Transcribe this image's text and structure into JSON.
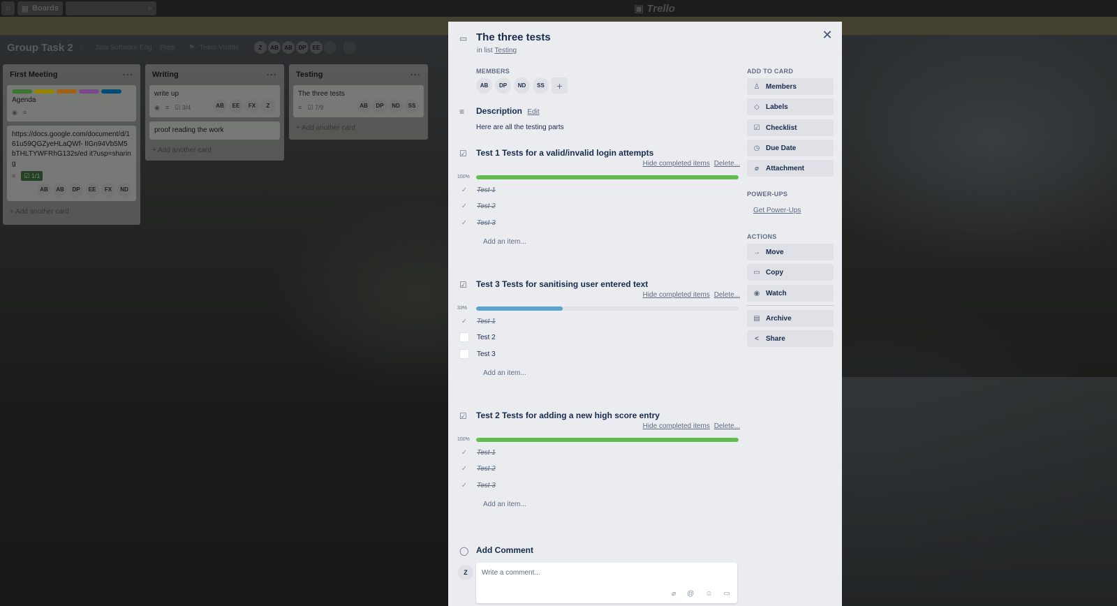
{
  "topbar": {
    "boards_label": "Boards",
    "logo": "Trello"
  },
  "board": {
    "title": "Group Task 2",
    "team": "Jata Software Eng",
    "team_badge": "Free",
    "visibility": "Team Visible",
    "members": [
      "Z",
      "AB",
      "AB",
      "DP",
      "EE"
    ]
  },
  "lists": [
    {
      "title": "First Meeting",
      "cards": [
        {
          "labels": [
            "#61bd4f",
            "#f2d600",
            "#ff9f1a",
            "#c377e0",
            "#0079bf"
          ],
          "text": "Agenda"
        },
        {
          "text": "https://docs.google.com/document/d/1 61u59QGZyeHLaQWf- lIGn94Vb5M5bTHLTYWFRhG132s/ed it?usp=sharing",
          "checklist": "1/1",
          "members": [
            "AB",
            "AB",
            "DP",
            "EE",
            "FX",
            "ND"
          ]
        }
      ],
      "add_card": "+ Add another card"
    },
    {
      "title": "Writing",
      "cards": [
        {
          "text": "write up",
          "checklist": "3/4",
          "members": [
            "AB",
            "EE",
            "FX",
            "Z"
          ]
        },
        {
          "text": "proof reading the work"
        }
      ],
      "add_card": "+ Add another card"
    },
    {
      "title": "Testing",
      "cards": [
        {
          "text": "The three tests",
          "checklist": "7/9",
          "members": [
            "AB",
            "DP",
            "ND",
            "SS"
          ]
        }
      ],
      "add_card": "+ Add another card"
    }
  ],
  "modal": {
    "title": "The three tests",
    "in_list_prefix": "in list",
    "in_list": "Testing",
    "members_label": "MEMBERS",
    "members": [
      "AB",
      "DP",
      "ND",
      "SS"
    ],
    "description_label": "Description",
    "edit_label": "Edit",
    "description": "Here are all the testing parts",
    "hide_completed": "Hide completed items",
    "delete": "Delete...",
    "add_item": "Add an item...",
    "checklists": [
      {
        "title": "Test 1 Tests for a valid/invalid login attempts",
        "percent_label": "100%",
        "progress": 1.0,
        "color": "#61bd4f",
        "items": [
          {
            "text": "Test 1",
            "done": true
          },
          {
            "text": "Test 2",
            "done": true
          },
          {
            "text": "Test 3",
            "done": true
          }
        ]
      },
      {
        "title": "Test 3 Tests for sanitising user entered text",
        "percent_label": "33%",
        "progress": 0.33,
        "color": "#5ba4cf",
        "items": [
          {
            "text": "Test 1",
            "done": true
          },
          {
            "text": "Test 2",
            "done": false
          },
          {
            "text": "Test 3",
            "done": false
          }
        ]
      },
      {
        "title": "Test 2 Tests for adding a new high score entry",
        "percent_label": "100%",
        "progress": 1.0,
        "color": "#61bd4f",
        "items": [
          {
            "text": "Test 1",
            "done": true
          },
          {
            "text": "Test 2",
            "done": true
          },
          {
            "text": "Test 3",
            "done": true
          }
        ]
      }
    ],
    "add_comment_label": "Add Comment",
    "comment_avatar": "Z",
    "comment_placeholder": "Write a comment...",
    "sidebar": {
      "add_to_card_label": "ADD TO CARD",
      "add_to_card": [
        "Members",
        "Labels",
        "Checklist",
        "Due Date",
        "Attachment"
      ],
      "powerups_label": "POWER-UPS",
      "powerups_link": "Get Power-Ups",
      "actions_label": "ACTIONS",
      "actions": [
        "Move",
        "Copy",
        "Watch"
      ],
      "extra_actions": [
        "Archive",
        "Share"
      ]
    }
  }
}
